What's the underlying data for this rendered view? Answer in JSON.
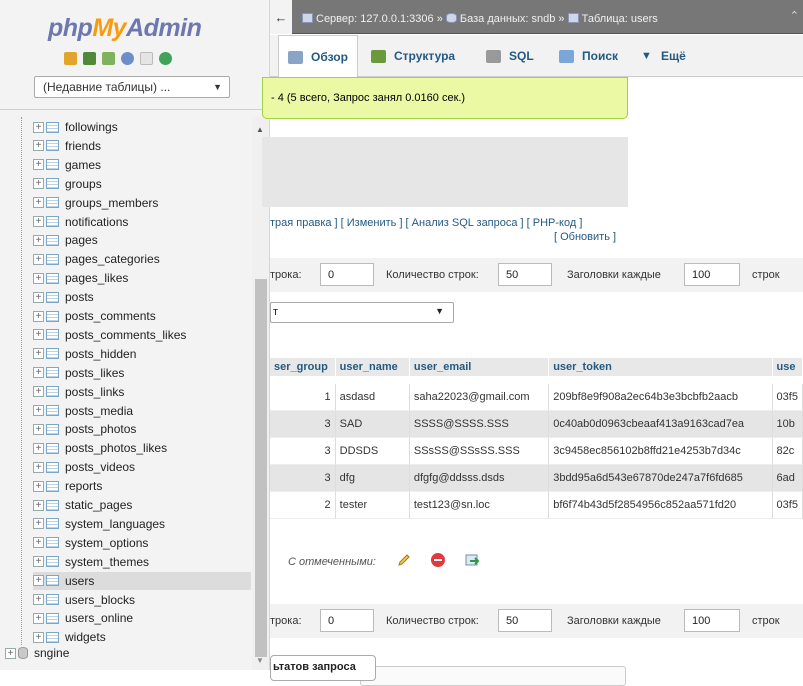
{
  "logo": {
    "php": "php",
    "my": "My",
    "admin": "Admin"
  },
  "nav": {
    "recent_tables": "(Недавние таблицы) ...",
    "tables": [
      "followings",
      "friends",
      "games",
      "groups",
      "groups_members",
      "notifications",
      "pages",
      "pages_categories",
      "pages_likes",
      "posts",
      "posts_comments",
      "posts_comments_likes",
      "posts_hidden",
      "posts_likes",
      "posts_links",
      "posts_media",
      "posts_photos",
      "posts_photos_likes",
      "posts_videos",
      "reports",
      "static_pages",
      "system_languages",
      "system_options",
      "system_themes",
      "users",
      "users_blocks",
      "users_online",
      "widgets"
    ],
    "selected_table": "users",
    "database": "sngine"
  },
  "breadcrumb": {
    "server": "Сервер: 127.0.0.1:3306 »",
    "database": "База данных: sndb »",
    "table": "Таблица: users"
  },
  "tabs": [
    {
      "label": "Обзор",
      "icon": "browse-icon",
      "color": "#8aa4c8"
    },
    {
      "label": "Структура",
      "icon": "structure-icon",
      "color": "#6b9a3c"
    },
    {
      "label": "SQL",
      "icon": "sql-icon",
      "color": "#999999"
    },
    {
      "label": "Поиск",
      "icon": "search-icon",
      "color": "#7aa6d8"
    },
    {
      "label": "Ещё",
      "icon": "chevron-down-icon",
      "color": "#333333"
    }
  ],
  "success_message": "- 4 (5 всего, Запрос занял 0.0160 сек.)",
  "sql_links": {
    "row1": "трая правка ] [ Изменить ] [ Анализ SQL запроса ] [ PHP-код ]",
    "row2": "[ Обновить ]"
  },
  "navigation": {
    "start_label": "трока:",
    "start_value": "0",
    "rows_label": "Количество строк:",
    "rows_value": "50",
    "headers_label": "Заголовки каждые",
    "headers_value": "100",
    "suffix": "строк"
  },
  "filter": {
    "value": "т"
  },
  "table": {
    "columns": [
      "ser_group",
      "user_name",
      "user_email",
      "user_token",
      "use"
    ],
    "rows": [
      [
        "1",
        "asdasd",
        "saha22023@gmail.com",
        "209bf8e9f908a2ec64b3e3bcbfb2aacb",
        "03f5"
      ],
      [
        "3",
        "SAD",
        "SSSS@SSSS.SSS",
        "0c40ab0d0963cbeaaf413a9163cad7ea",
        "10b"
      ],
      [
        "3",
        "DDSDS",
        "SSsSS@SSsSS.SSS",
        "3c9458ec856102b8ffd21e4253b7d34c",
        "82c"
      ],
      [
        "3",
        "dfg",
        "dfgfg@ddsss.dsds",
        "3bdd95a6d543e67870de247a7f6fd685",
        "6ad"
      ],
      [
        "2",
        "tester",
        "test123@sn.loc",
        "bf6f74b43d5f2854956c852aa571fd20",
        "03f5"
      ]
    ]
  },
  "with_selected": {
    "label": "С отмеченными:",
    "actions": [
      "edit-icon",
      "delete-icon",
      "export-icon"
    ]
  },
  "result_ops": {
    "label": "ьтатов запроса"
  }
}
